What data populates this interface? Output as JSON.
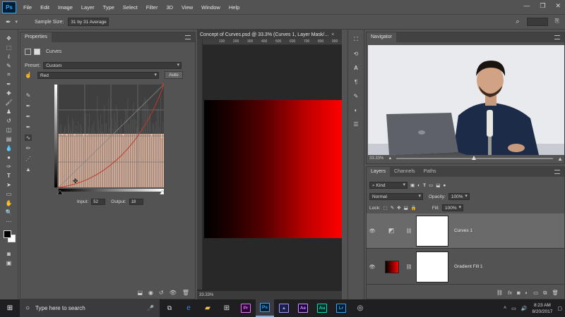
{
  "menu": {
    "app_logo": "Ps",
    "items": [
      "File",
      "Edit",
      "Image",
      "Layer",
      "Type",
      "Select",
      "Filter",
      "3D",
      "View",
      "Window",
      "Help"
    ]
  },
  "options": {
    "sample_size_label": "Sample Size:",
    "sample_size_value": "31 by 31 Average"
  },
  "properties": {
    "tab": "Properties",
    "title": "Curves",
    "preset_label": "Preset:",
    "preset_value": "Custom",
    "channel_value": "Red",
    "auto_button": "Auto",
    "input_label": "Input:",
    "input_value": "52",
    "output_label": "Output:",
    "output_value": "18"
  },
  "document": {
    "tab_title": "Concept of Curves.psd @ 33.3% (Curves 1, Layer Mask/...",
    "close_icon": "×",
    "ruler_numbers": [
      "100",
      "200",
      "300",
      "400",
      "500",
      "600",
      "700",
      "800",
      "900"
    ],
    "zoom_status": "33.33%"
  },
  "navigator": {
    "tab": "Navigator",
    "zoom": "33.33%"
  },
  "layers": {
    "tabs": [
      "Layers",
      "Channels",
      "Paths"
    ],
    "filter_kind": "Kind",
    "blend_mode": "Normal",
    "opacity_label": "Opacity:",
    "opacity_value": "100%",
    "lock_label": "Lock:",
    "fill_label": "Fill:",
    "fill_value": "100%",
    "items": [
      {
        "name": "Curves 1",
        "selected": true
      },
      {
        "name": "Gradient Fill 1",
        "selected": false
      }
    ]
  },
  "taskbar": {
    "search_placeholder": "Type here to search",
    "apps": [
      "Pr",
      "Ps",
      "Ae",
      "Au",
      "Lr"
    ],
    "time": "8:23 AM",
    "date": "8/20/2017"
  },
  "colors": {
    "curve_bg": "#f6c3a8",
    "canvas_red": "#ff0000",
    "ps_blue": "#31a8ff"
  }
}
